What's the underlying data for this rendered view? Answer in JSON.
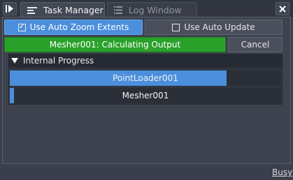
{
  "tabs": [
    {
      "label": "Task Manager",
      "icon": "list-icon",
      "active": true
    },
    {
      "label": "Log Window",
      "icon": "log-list-icon",
      "active": false
    }
  ],
  "toolbar": {
    "auto_zoom_label": "Use Auto Zoom Extents",
    "auto_zoom_checked": true,
    "auto_update_label": "Use Auto Update",
    "auto_update_checked": false
  },
  "status": {
    "label": "Mesher001: Calculating Output",
    "cancel_label": "Cancel"
  },
  "progress_group": {
    "title": "Internal Progress",
    "items": [
      {
        "label": "PointLoader001",
        "progress": 0.8
      },
      {
        "label": "Mesher001",
        "progress": 0.015
      }
    ]
  },
  "footer": {
    "busy_label": "Busy"
  },
  "colors": {
    "accent": "#4b8fdc",
    "status_green": "#2aa12a",
    "background": "#3a3f4b"
  }
}
